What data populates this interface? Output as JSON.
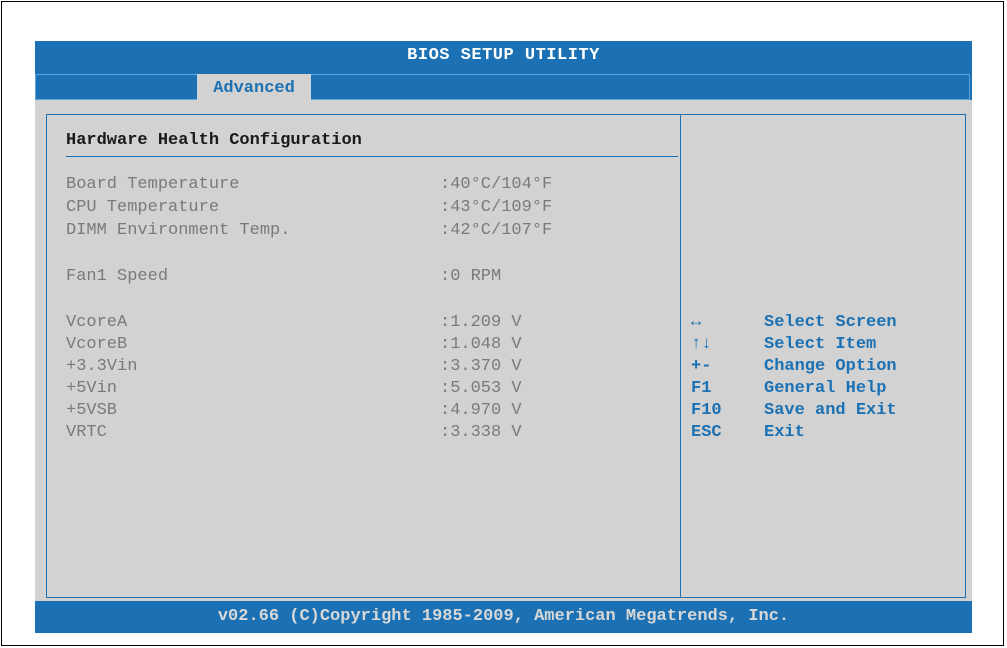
{
  "window": {
    "title": "BIOS SETUP UTILITY"
  },
  "tabs": [
    {
      "label": "Advanced",
      "active": true
    }
  ],
  "section": {
    "title": "Hardware Health Configuration"
  },
  "readings": [
    {
      "label": "Board Temperature",
      "value": ":40°C/104°F"
    },
    {
      "label": "CPU Temperature",
      "value": ":43°C/109°F"
    },
    {
      "label": "DIMM Environment Temp.",
      "value": ":42°C/107°F"
    },
    {
      "label": "Fan1 Speed",
      "value": ":0 RPM"
    },
    {
      "label": "VcoreA",
      "value": ":1.209 V"
    },
    {
      "label": "VcoreB",
      "value": ":1.048 V"
    },
    {
      "label": "+3.3Vin",
      "value": ":3.370 V"
    },
    {
      "label": "+5Vin",
      "value": ":5.053 V"
    },
    {
      "label": "+5VSB",
      "value": ":4.970 V"
    },
    {
      "label": "VRTC",
      "value": ":3.338 V"
    }
  ],
  "help": [
    {
      "key": "↔",
      "desc": "Select Screen",
      "icon": "left-right-arrow-icon"
    },
    {
      "key": "↑↓",
      "desc": "Select Item",
      "icon": "up-down-arrow-icon"
    },
    {
      "key": "+-",
      "desc": "Change Option"
    },
    {
      "key": "F1",
      "desc": "General Help"
    },
    {
      "key": "F10",
      "desc": "Save and Exit"
    },
    {
      "key": "ESC",
      "desc": "Exit"
    }
  ],
  "footer": {
    "text": "v02.66 (C)Copyright 1985-2009, American Megatrends, Inc."
  },
  "colors": {
    "accent_blue": "#1b71b3",
    "panel_gray": "#d2d2d2",
    "disabled_text": "#7a7a7a"
  }
}
